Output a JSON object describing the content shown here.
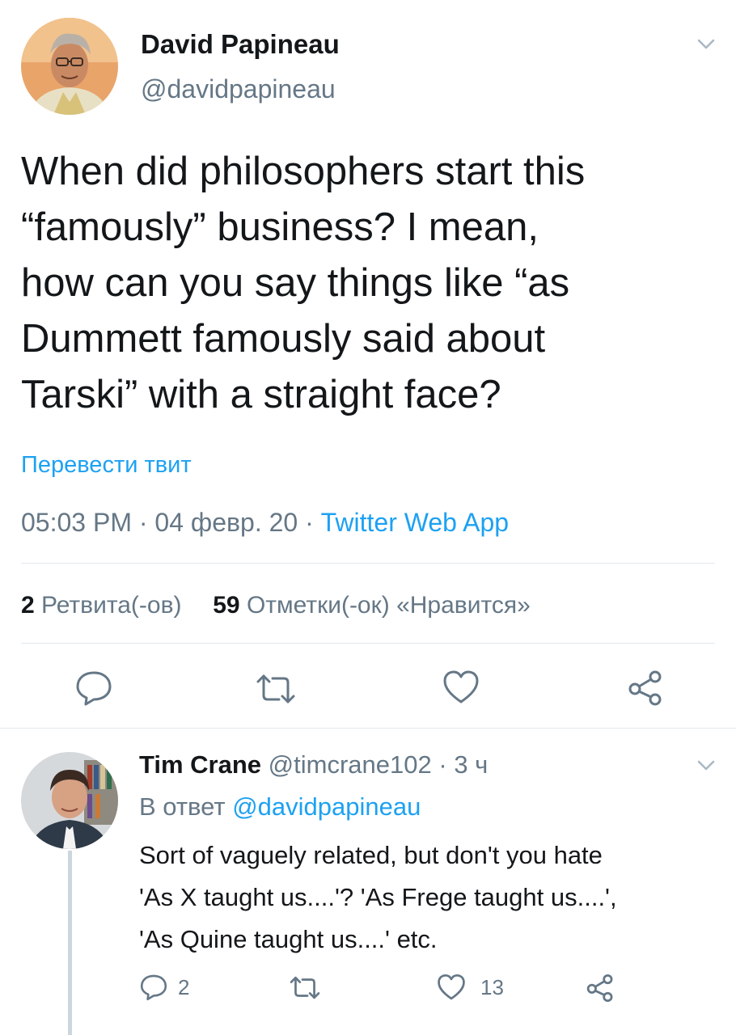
{
  "tweet": {
    "author_name": "David Papineau",
    "author_handle": "@davidpapineau",
    "text_lines": [
      "When did philosophers start this",
      "“famously” business? I mean,",
      "how can you say things like “as",
      "Dummett famously said about",
      "Tarski” with a straight face?"
    ],
    "translate_label": "Перевести твит",
    "time": "05:03 PM",
    "date": "04 февр. 20",
    "sep": "·",
    "source": "Twitter Web App",
    "retweets_count": "2",
    "retweets_label": "Ретвита(-ов)",
    "likes_count": "59",
    "likes_label": "Отметки(-ок) «Нравится»"
  },
  "reply": {
    "author_name": "Tim Crane",
    "author_handle": "@timcrane102",
    "time_ago": "3 ч",
    "sep": "·",
    "reply_to_prefix": "В ответ",
    "reply_to_handle": "@davidpapineau",
    "text_lines": [
      "Sort of vaguely related, but don't you hate",
      "'As X taught us....'? 'As Frege taught us....',",
      "'As Quine taught us....' etc."
    ],
    "reply_count": "2",
    "like_count": "13"
  },
  "icons": {
    "reply": "reply-icon",
    "retweet": "retweet-icon",
    "like": "heart-icon",
    "share": "share-icon",
    "menu": "chevron-down-icon"
  },
  "colors": {
    "link": "#1da1f2",
    "secondary_text": "#657786",
    "divider": "#e1e8ed"
  }
}
